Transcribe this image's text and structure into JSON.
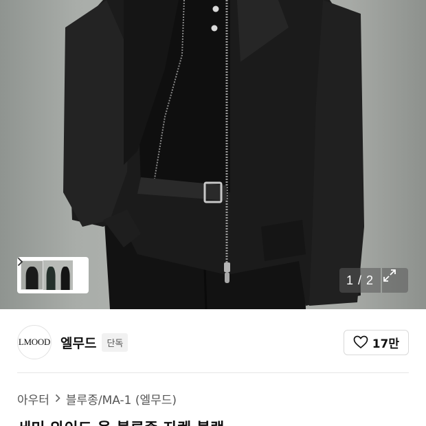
{
  "gallery": {
    "current_page": "1 / 2",
    "image_count": 2,
    "thumbnails": [
      {
        "name": "thumb-look-1"
      },
      {
        "name": "thumb-look-2"
      },
      {
        "name": "thumb-look-3"
      }
    ]
  },
  "brand": {
    "logo_text": "LMOOD",
    "name": "엘무드",
    "badge": "단독",
    "like_count": "17만"
  },
  "breadcrumb": {
    "category": "아우터",
    "subcategory": "블루종/MA-1 (엘무드)"
  },
  "product": {
    "title": "세미 와이드 울 블루종 자켓 블랙"
  },
  "colors": {
    "text_primary": "#111111",
    "text_secondary": "#555555",
    "badge_bg": "#f1f1f1",
    "divider": "#e6e6e6"
  },
  "icons": {
    "thumb_next": "chevron-right-icon",
    "expand": "expand-icon",
    "like": "heart-outline-icon"
  }
}
